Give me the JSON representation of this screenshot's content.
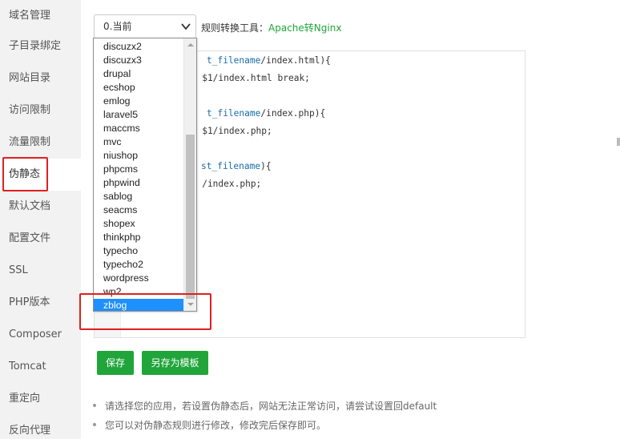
{
  "sidebar": {
    "items": [
      {
        "label": "域名管理"
      },
      {
        "label": "子目录绑定"
      },
      {
        "label": "网站目录"
      },
      {
        "label": "访问限制"
      },
      {
        "label": "流量限制"
      },
      {
        "label": "伪静态",
        "active": true
      },
      {
        "label": "默认文档"
      },
      {
        "label": "配置文件"
      },
      {
        "label": "SSL"
      },
      {
        "label": "PHP版本"
      },
      {
        "label": "Composer"
      },
      {
        "label": "Tomcat"
      },
      {
        "label": "重定向"
      },
      {
        "label": "反向代理"
      }
    ]
  },
  "rule_select": {
    "value": "0.当前",
    "options": [
      "discuzx2",
      "discuzx3",
      "drupal",
      "ecshop",
      "emlog",
      "laravel5",
      "maccms",
      "mvc",
      "niushop",
      "phpcms",
      "phpwind",
      "sablog",
      "seacms",
      "shopex",
      "thinkphp",
      "typecho",
      "typecho2",
      "wordpress",
      "wp2",
      "zblog"
    ],
    "highlighted_option": "zblog"
  },
  "converter": {
    "label": "规则转换工具：",
    "link": "Apache转Nginx"
  },
  "editor": {
    "lines": [
      {
        "pre": "",
        "kw": "t_filename",
        "post": "/index.html){"
      },
      {
        "pre": "   $1/index.html break;",
        "kw": "",
        "post": ""
      },
      {
        "pre": "",
        "kw": "t_filename",
        "post": "/index.php){"
      },
      {
        "pre": "   $1/index.php;",
        "kw": "",
        "post": ""
      },
      {
        "pre": "",
        "kw": "st_filename",
        "post": "){"
      },
      {
        "pre": "   /index.php;",
        "kw": "",
        "post": ""
      }
    ]
  },
  "buttons": {
    "save": "保存",
    "save_template": "另存为模板"
  },
  "tips": [
    "请选择您的应用，若设置伪静态后，网站无法正常访问，请尝试设置回default",
    "您可以对伪静态规则进行修改，修改完后保存即可。"
  ],
  "colors": {
    "accent_green": "#20a53a",
    "highlight_red": "#e02020",
    "selection_blue": "#1e90ff",
    "code_keyword": "#1a6ea8"
  }
}
